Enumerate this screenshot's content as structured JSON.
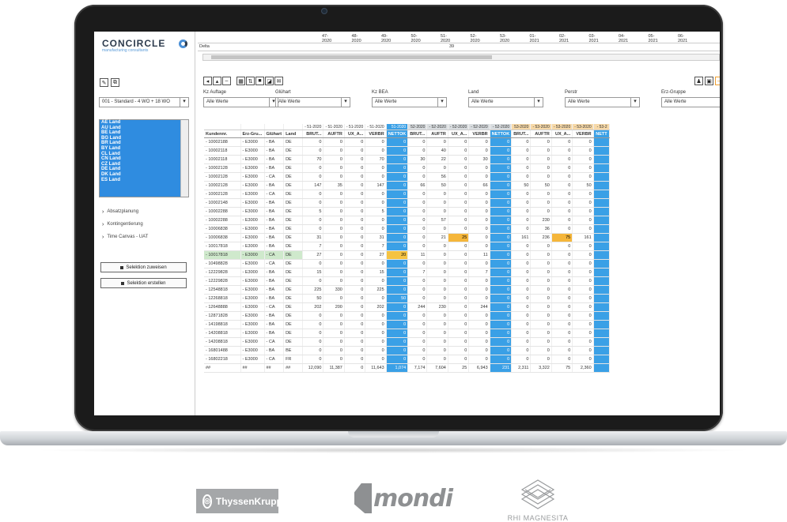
{
  "app": {
    "brand": "CONCIRCLE",
    "brand_sub": "manufacturing consultants"
  },
  "top": {
    "weeks": [
      "47-2020",
      "48-2020",
      "49-2020",
      "50-2020",
      "51-2020",
      "52-2020",
      "53-2020",
      "01-2021",
      "02-2021",
      "03-2021",
      "04-2021",
      "05-2021",
      "06-2021"
    ],
    "delta_label": "Delta",
    "delta_value": "39"
  },
  "left": {
    "preset": "001 - Standard - 4 WO + 18 WO",
    "countries": [
      "AE Land",
      "AU Land",
      "BE Land",
      "BG Land",
      "BR Land",
      "BY Land",
      "CL Land",
      "CN Land",
      "CZ Land",
      "DE Land",
      "DK Land",
      "ES Land"
    ],
    "nav": [
      "Absatzplanung",
      "Kontingentierung",
      "Time Canvas - UAT"
    ],
    "btn_assign": "Selektion zuweisen",
    "btn_create": "Selektion erstellen"
  },
  "filters": [
    {
      "label": "Kz Auftage",
      "value": "Alle Werte"
    },
    {
      "label": "Glühart",
      "value": "Alle Werte"
    },
    {
      "label": "Kz BEA",
      "value": "Alle Werte"
    },
    {
      "label": "Land",
      "value": "Alle Werte"
    },
    {
      "label": "Perstr",
      "value": "Alle Werte"
    },
    {
      "label": "Erz-Gruppe",
      "value": "Alle Werte"
    }
  ],
  "table": {
    "periods": [
      "- 51-2020",
      "- 51-2020",
      "- 51-2020",
      "- 51-2020",
      "51-2020",
      "52-2020",
      "- 52-2020",
      "- 52-2020",
      "- 52-2020",
      "- 52-2020",
      "53-2020",
      "- 53-2020",
      "- 53-2020",
      "- 53-2020",
      "- 53-2"
    ],
    "columns": [
      "Kundennr.",
      "Erz-Gru...",
      "Glühart",
      "Land",
      "BRUT...",
      "AUFTR",
      "UX_A...",
      "VERBR",
      "NETTOK",
      "BRUT...",
      "AUFTR",
      "UX_A...",
      "VERBR",
      "NETTOK",
      "BRUT...",
      "AUFTR",
      "UX_A...",
      "VERBR",
      "NETT"
    ],
    "rows": [
      [
        "- 10002188",
        "- E3000",
        "- BA",
        "DE",
        "0",
        "0",
        "0",
        "0",
        "0",
        "0",
        "0",
        "0",
        "0",
        "0",
        "0",
        "0",
        "0",
        "0",
        ""
      ],
      [
        "- 10002118",
        "- E3000",
        "- BA",
        "DE",
        "0",
        "0",
        "0",
        "0",
        "0",
        "0",
        "40",
        "0",
        "0",
        "0",
        "0",
        "0",
        "0",
        "0",
        ""
      ],
      [
        "- 10002118",
        "- E3000",
        "- BA",
        "DE",
        "70",
        "0",
        "0",
        "70",
        "0",
        "30",
        "22",
        "0",
        "30",
        "0",
        "0",
        "0",
        "0",
        "0",
        ""
      ],
      [
        "- 10002128",
        "- E3000",
        "- BA",
        "DE",
        "0",
        "0",
        "0",
        "0",
        "0",
        "0",
        "0",
        "0",
        "0",
        "0",
        "0",
        "0",
        "0",
        "0",
        ""
      ],
      [
        "- 10002128",
        "- E3000",
        "- CA",
        "DE",
        "0",
        "0",
        "0",
        "0",
        "0",
        "0",
        "56",
        "0",
        "0",
        "0",
        "0",
        "0",
        "0",
        "0",
        ""
      ],
      [
        "- 10002128",
        "- E3000",
        "- BA",
        "DE",
        "147",
        "35",
        "0",
        "147",
        "0",
        "66",
        "50",
        "0",
        "66",
        "0",
        "50",
        "50",
        "0",
        "50",
        ""
      ],
      [
        "- 10002128",
        "- E3000",
        "- CA",
        "DE",
        "0",
        "0",
        "0",
        "0",
        "0",
        "0",
        "0",
        "0",
        "0",
        "0",
        "0",
        "0",
        "0",
        "0",
        ""
      ],
      [
        "- 10002148",
        "- E3000",
        "- BA",
        "DE",
        "0",
        "0",
        "0",
        "0",
        "0",
        "0",
        "0",
        "0",
        "0",
        "0",
        "0",
        "0",
        "0",
        "0",
        ""
      ],
      [
        "- 10002288",
        "- E3000",
        "- BA",
        "DE",
        "5",
        "0",
        "0",
        "5",
        "0",
        "0",
        "0",
        "0",
        "0",
        "0",
        "0",
        "0",
        "0",
        "0",
        ""
      ],
      [
        "- 10002288",
        "- E3000",
        "- BA",
        "DE",
        "0",
        "0",
        "0",
        "0",
        "0",
        "0",
        "57",
        "0",
        "0",
        "0",
        "0",
        "230",
        "0",
        "0",
        ""
      ],
      [
        "- 10006838",
        "- E3000",
        "- BA",
        "DE",
        "0",
        "0",
        "0",
        "0",
        "0",
        "0",
        "0",
        "0",
        "0",
        "0",
        "0",
        "36",
        "0",
        "0",
        ""
      ],
      [
        "- 10006838",
        "- E3000",
        "- BA",
        "DE",
        "31",
        "0",
        "0",
        "31",
        "0",
        "0",
        "21",
        "25",
        "0",
        "0",
        "161",
        "236",
        "75",
        "161",
        ""
      ],
      [
        "- 10017818",
        "- E3000",
        "- BA",
        "DE",
        "7",
        "0",
        "0",
        "7",
        "0",
        "0",
        "0",
        "0",
        "0",
        "0",
        "0",
        "0",
        "0",
        "0",
        ""
      ],
      [
        "- 10017818",
        "- E3000",
        "- CA",
        "DE",
        "27",
        "0",
        "0",
        "27",
        "20",
        "11",
        "0",
        "0",
        "11",
        "0",
        "0",
        "0",
        "0",
        "0",
        ""
      ],
      [
        "- 10498828",
        "- E3000",
        "- CA",
        "DE",
        "0",
        "0",
        "0",
        "0",
        "0",
        "0",
        "0",
        "0",
        "0",
        "0",
        "0",
        "0",
        "0",
        "0",
        ""
      ],
      [
        "- 12229828",
        "- E3000",
        "- BA",
        "DE",
        "15",
        "0",
        "0",
        "15",
        "0",
        "7",
        "0",
        "0",
        "7",
        "0",
        "0",
        "0",
        "0",
        "0",
        ""
      ],
      [
        "- 12229828",
        "- E3000",
        "- BA",
        "DE",
        "0",
        "0",
        "0",
        "0",
        "0",
        "0",
        "0",
        "0",
        "0",
        "0",
        "0",
        "0",
        "0",
        "0",
        ""
      ],
      [
        "- 12548818",
        "- E3000",
        "- BA",
        "DE",
        "225",
        "330",
        "0",
        "225",
        "0",
        "0",
        "0",
        "0",
        "0",
        "0",
        "0",
        "0",
        "0",
        "0",
        ""
      ],
      [
        "- 12268818",
        "- E3000",
        "- BA",
        "DE",
        "50",
        "0",
        "0",
        "0",
        "50",
        "0",
        "0",
        "0",
        "0",
        "0",
        "0",
        "0",
        "0",
        "0",
        ""
      ],
      [
        "- 12648888",
        "- E3000",
        "- CA",
        "DE",
        "202",
        "200",
        "0",
        "202",
        "0",
        "244",
        "230",
        "0",
        "244",
        "0",
        "0",
        "0",
        "0",
        "0",
        ""
      ],
      [
        "- 12871828",
        "- E3000",
        "- BA",
        "DE",
        "0",
        "0",
        "0",
        "0",
        "0",
        "0",
        "0",
        "0",
        "0",
        "0",
        "0",
        "0",
        "0",
        "0",
        ""
      ],
      [
        "- 14198818",
        "- E3000",
        "- BA",
        "DE",
        "0",
        "0",
        "0",
        "0",
        "0",
        "0",
        "0",
        "0",
        "0",
        "0",
        "0",
        "0",
        "0",
        "0",
        ""
      ],
      [
        "- 14208818",
        "- E3000",
        "- BA",
        "DE",
        "0",
        "0",
        "0",
        "0",
        "0",
        "0",
        "0",
        "0",
        "0",
        "0",
        "0",
        "0",
        "0",
        "0",
        ""
      ],
      [
        "- 14208818",
        "- E3000",
        "- CA",
        "DE",
        "0",
        "0",
        "0",
        "0",
        "0",
        "0",
        "0",
        "0",
        "0",
        "0",
        "0",
        "0",
        "0",
        "0",
        ""
      ],
      [
        "- 16801488",
        "- E3000",
        "- BA",
        "BE",
        "0",
        "0",
        "0",
        "0",
        "0",
        "0",
        "0",
        "0",
        "0",
        "0",
        "0",
        "0",
        "0",
        "0",
        ""
      ],
      [
        "- 16802218",
        "- E3000",
        "- CA",
        "FR",
        "0",
        "0",
        "0",
        "0",
        "0",
        "0",
        "0",
        "0",
        "0",
        "0",
        "0",
        "0",
        "0",
        "0",
        ""
      ],
      [
        "##",
        "##",
        "##",
        "##",
        "12,090",
        "11,387",
        "0",
        "11,643",
        "1,074",
        "7,174",
        "7,604",
        "25",
        "6,943",
        "231",
        "2,311",
        "3,322",
        "75",
        "2,360",
        ""
      ]
    ]
  },
  "logos": {
    "thyssen": "ThyssenKrupp",
    "mondi": "mondi",
    "rhi": "RHI MAGNESITA"
  }
}
